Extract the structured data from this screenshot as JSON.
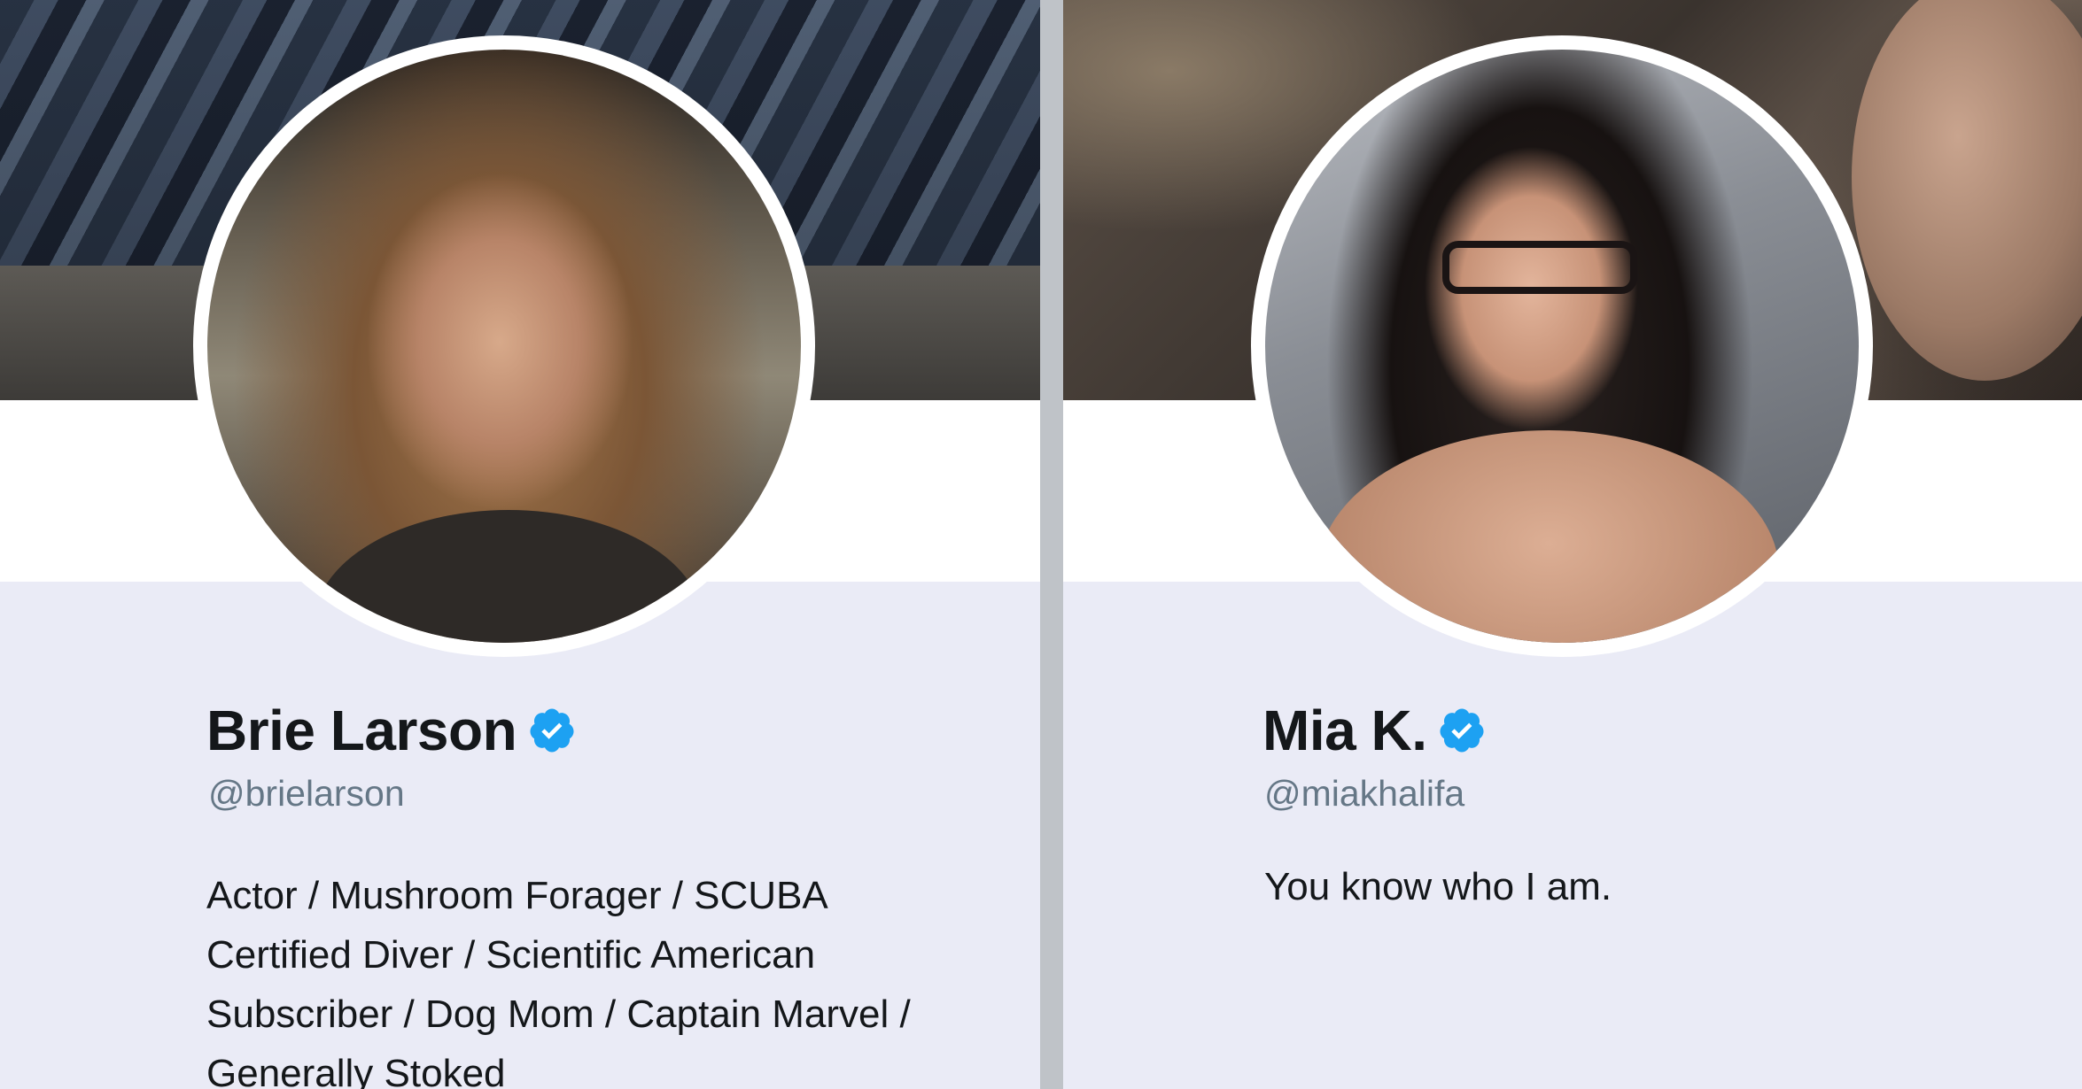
{
  "profiles": [
    {
      "display_name": "Brie Larson",
      "handle": "@brielarson",
      "verified": true,
      "verified_icon": "verified-badge-icon",
      "bio_lines": [
        "Actor / Mushroom Forager / SCUBA",
        "Certified Diver / Scientific American",
        "Subscriber / Dog Mom / Captain Marvel /",
        "Generally Stoked"
      ]
    },
    {
      "display_name": "Mia K.",
      "handle": "@miakhalifa",
      "verified": true,
      "verified_icon": "verified-badge-icon",
      "bio_lines": [
        "You know who I am."
      ]
    }
  ],
  "colors": {
    "verified_blue": "#1da1f2",
    "name_text": "#14171a",
    "handle_text": "#657786",
    "profile_background": "#eaebf6"
  }
}
